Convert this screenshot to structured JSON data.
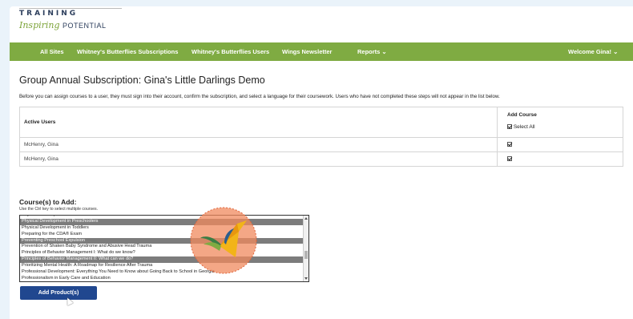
{
  "logo": {
    "top": "TRAINING",
    "script": "Inspiring",
    "sub": "POTENTIAL"
  },
  "nav": {
    "items": [
      "All Sites",
      "Whitney's Butterflies Subscriptions",
      "Whitney's Butterflies Users",
      "Wings Newsletter"
    ],
    "reports": "Reports ⌄",
    "welcome": "Welcome Gina! ⌄"
  },
  "title": "Group Annual Subscription: Gina's Little Darlings Demo",
  "description": "Before you can assign courses to a user, they must sign into their account, confirm the subscription, and select a language for their coursework. Users who have not completed these steps will not appear in the list below.",
  "users_table": {
    "col_active": "Active Users",
    "col_add": "Add Course",
    "select_all": "Select All",
    "rows": [
      {
        "name": "McHenry, Gina",
        "checked": true
      },
      {
        "name": "McHenry, Gina",
        "checked": true
      }
    ]
  },
  "courses": {
    "label": "Course(s) to Add:",
    "hint": "Use the Ctrl key to select multiple courses.",
    "options": [
      {
        "text": "Physical Development in Infants",
        "selected": false
      },
      {
        "text": "Physical Development in Preschoolers",
        "selected": true
      },
      {
        "text": "Physical Development in Toddlers",
        "selected": false
      },
      {
        "text": "Preparing for the CDA® Exam",
        "selected": false
      },
      {
        "text": "Preventing Preschool Expulsion",
        "selected": true
      },
      {
        "text": "Prevention of Shaken Baby Syndrome and Abusive Head Trauma",
        "selected": false
      },
      {
        "text": "Principles of Behavior Management I: What do we know?",
        "selected": false
      },
      {
        "text": "Principles of Behavior Management II: What can we do?",
        "selected": true
      },
      {
        "text": "Prioritizing Mental Health: A Roadmap for Resilience After Trauma",
        "selected": false
      },
      {
        "text": "Professional Development: Everything You Need to Know about Going Back to School in Georgia",
        "selected": false
      },
      {
        "text": "Professionalism in Early Care and Education",
        "selected": false
      }
    ]
  },
  "add_button": "Add Product(s)",
  "colors": {
    "nav": "#7fab42",
    "button": "#20478f",
    "selected": "#7c7c7c",
    "overlay": "#f08a5d"
  }
}
